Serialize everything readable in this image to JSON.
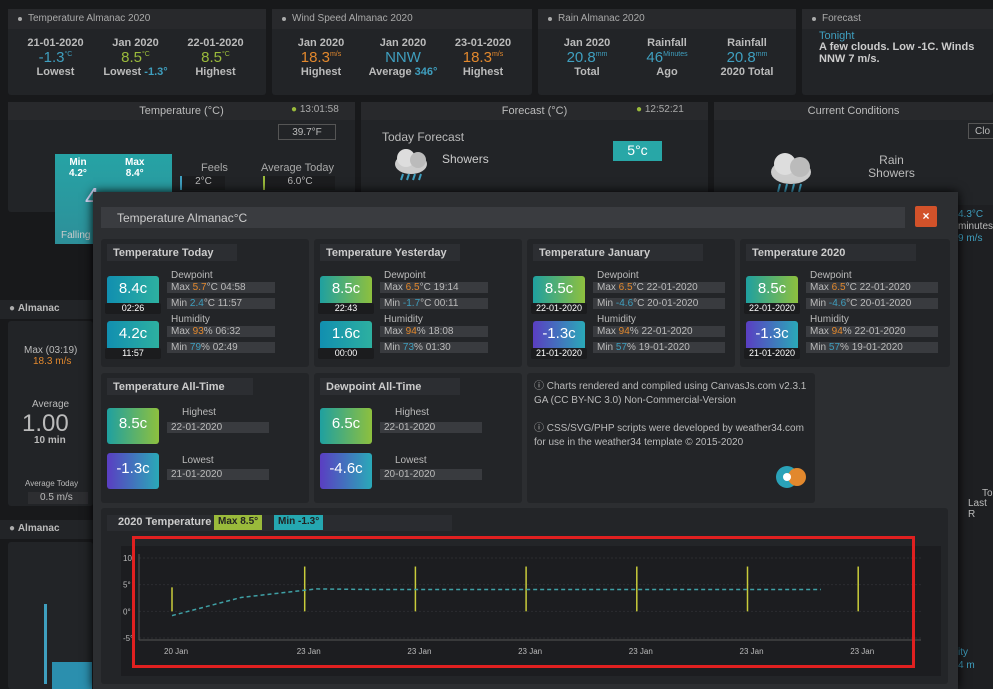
{
  "top": {
    "temp": {
      "title": "Temperature Almanac 2020",
      "cols": [
        {
          "h": "21-01-2020",
          "v": "-1.3",
          "u": "°C",
          "l": "Lowest"
        },
        {
          "h": "Jan 2020",
          "v": "8.5",
          "u": "°C",
          "l": "Lowest",
          "l2": "-1.3°"
        },
        {
          "h": "22-01-2020",
          "v": "8.5",
          "u": "°C",
          "l": "Highest"
        }
      ]
    },
    "wind": {
      "title": "Wind Speed Almanac 2020",
      "cols": [
        {
          "h": "Jan 2020",
          "v": "18.3",
          "u": "m/s",
          "l": "Highest"
        },
        {
          "h": "Jan 2020",
          "v": "NNW",
          "u": "",
          "l": "Average",
          "l2": "346°"
        },
        {
          "h": "23-01-2020",
          "v": "18.3",
          "u": "m/s",
          "l": "Highest"
        }
      ]
    },
    "rain": {
      "title": "Rain Almanac 2020",
      "cols": [
        {
          "h": "Jan 2020",
          "v": "20.8",
          "u": "mm",
          "l": "Total"
        },
        {
          "h": "Rainfall",
          "v": "46",
          "u": "Minutes",
          "l": "Ago"
        },
        {
          "h": "Rainfall",
          "v": "20.8",
          "u": "mm",
          "l": "2020 Total"
        }
      ]
    },
    "forecast": {
      "title": "Forecast",
      "tonight": "Tonight",
      "text": "A few clouds. Low -1C. Winds NNW 7 m/s."
    }
  },
  "second": {
    "temp": {
      "title": "Temperature (°C)",
      "time": "13:01:58",
      "feels_max": "39.7°F",
      "min_label": "Min",
      "min_val": "4.2°",
      "max_label": "Max",
      "max_val": "8.4°",
      "big": "4",
      "feels": "Feels",
      "feels_val": "2°C",
      "avg": "Average Today",
      "avg_val": "6.0°C",
      "falling": "Falling"
    },
    "forecast": {
      "title": "Forecast (°C)",
      "time": "12:52:21",
      "today": "Today Forecast",
      "cond": "Showers",
      "badge": "5°c"
    },
    "current": {
      "title": "Current Conditions",
      "btn": "Clo",
      "l1": "Rain",
      "l2": "Showers",
      "r1": "4.3°C",
      "r2": "minutes",
      "r3": "9 m/s"
    }
  },
  "left": {
    "almanac1": "Almanac",
    "max_lbl": "Max (03:19)",
    "max_val": "18.3 m/s",
    "avg_lbl": "Average",
    "avg_big": "1.00",
    "avg_unit": "10 min",
    "avgtoday_lbl": "Average Today",
    "avgtoday_val": "0.5 m/s",
    "almanac2": "Almanac",
    "t2": "To",
    "last": "Last R",
    "ity": "ity",
    "m4": "4 m"
  },
  "modal": {
    "title": "Temperature Almanac°C",
    "close": "×",
    "panels": [
      {
        "h": "Temperature Today",
        "c1": {
          "v": "8.4c",
          "d": "02:26"
        },
        "c2": {
          "v": "4.2c",
          "d": "11:57"
        },
        "dew": "Dewpoint",
        "dmax_pre": "Max ",
        "dmax_v": "5.7",
        "dmax_post": "°C 04:58",
        "dmin_pre": "Min ",
        "dmin_v": "2.4",
        "dmin_post": "°C 11:57",
        "hum": "Humidity",
        "hmax_pre": "Max ",
        "hmax_v": "93",
        "hmax_post": "% 06:32",
        "hmin_pre": "Min ",
        "hmin_v": "79",
        "hmin_post": "% 02:49"
      },
      {
        "h": "Temperature Yesterday",
        "c1": {
          "v": "8.5c",
          "d": "22:43"
        },
        "c2": {
          "v": "1.6c",
          "d": "00:00"
        },
        "dew": "Dewpoint",
        "dmax_pre": "Max ",
        "dmax_v": "6.5",
        "dmax_post": "°C 19:14",
        "dmin_pre": "Min ",
        "dmin_v": "-1.7",
        "dmin_post": "°C 00:11",
        "hum": "Humidity",
        "hmax_pre": "Max ",
        "hmax_v": "94",
        "hmax_post": "% 18:08",
        "hmin_pre": "Min ",
        "hmin_v": "73",
        "hmin_post": "% 01:30"
      },
      {
        "h": "Temperature January",
        "c1": {
          "v": "8.5c",
          "d": "22-01-2020"
        },
        "c2": {
          "v": "-1.3c",
          "d": "21-01-2020"
        },
        "dew": "Dewpoint",
        "dmax_pre": "Max ",
        "dmax_v": "6.5",
        "dmax_post": "°C 22-01-2020",
        "dmin_pre": "Min ",
        "dmin_v": "-4.6",
        "dmin_post": "°C 20-01-2020",
        "hum": "Humidity",
        "hmax_pre": "Max ",
        "hmax_v": "94",
        "hmax_post": "% 22-01-2020",
        "hmin_pre": "Min ",
        "hmin_v": "57",
        "hmin_post": "% 19-01-2020"
      },
      {
        "h": "Temperature 2020",
        "c1": {
          "v": "8.5c",
          "d": "22-01-2020"
        },
        "c2": {
          "v": "-1.3c",
          "d": "21-01-2020"
        },
        "dew": "Dewpoint",
        "dmax_pre": "Max ",
        "dmax_v": "6.5",
        "dmax_post": "°C 22-01-2020",
        "dmin_pre": "Min ",
        "dmin_v": "-4.6",
        "dmin_post": "°C 20-01-2020",
        "hum": "Humidity",
        "hmax_pre": "Max ",
        "hmax_v": "94",
        "hmax_post": "% 22-01-2020",
        "hmin_pre": "Min ",
        "hmin_v": "57",
        "hmin_post": "% 19-01-2020"
      }
    ],
    "alltime": {
      "h": "Temperature All-Time",
      "c1": "8.5c",
      "high": "Highest",
      "highd": "22-01-2020",
      "c2": "-1.3c",
      "low": "Lowest",
      "lowd": "21-01-2020"
    },
    "dewall": {
      "h": "Dewpoint All-Time",
      "c1": "6.5c",
      "high": "Highest",
      "highd": "22-01-2020",
      "c2": "-4.6c",
      "low": "Lowest",
      "lowd": "20-01-2020"
    },
    "info": {
      "l1": "ⓘ Charts rendered and compiled using CanvasJs.com v2.3.1 GA (CC BY-NC 3.0) Non-Commercial-Version",
      "l2": "ⓘ CSS/SVG/PHP scripts were developed by weather34.com for use in the weather34 template © 2015-2020"
    },
    "chart_title": "2020 Temperature",
    "max_badge": "Max 8.5°",
    "min_badge": "Min -1.3°"
  },
  "colors": {
    "accent_orange": "#e2882d",
    "accent_blue": "#3f9fbf",
    "accent_green": "#9aba3b",
    "close_red": "#d2522a",
    "highlight_box": "#e02020"
  },
  "chart_data": {
    "type": "line",
    "title": "2020 Temperature",
    "x": [
      "20 Jan",
      "23 Jan",
      "23 Jan",
      "23 Jan",
      "23 Jan",
      "23 Jan",
      "23 Jan",
      "23 Jan"
    ],
    "ylim": [
      -5,
      10
    ],
    "yticks": [
      "10°",
      "5°",
      "0°",
      "-5°"
    ],
    "ytick_values": [
      10,
      5,
      0,
      -5
    ],
    "series": [
      {
        "values": [
          -0.8,
          2.6,
          4.2,
          4.1,
          4.1,
          4.1,
          4.1,
          4.1
        ],
        "color": "#3fa0a5",
        "dashed": true
      }
    ],
    "ranges": [
      {
        "low": 0,
        "high": 4.5
      },
      {
        "low": 0,
        "high": 8.4
      },
      {
        "low": 0,
        "high": 8.4
      },
      {
        "low": 0,
        "high": 8.4
      },
      {
        "low": 0,
        "high": 8.4
      },
      {
        "low": 0,
        "high": 8.4
      },
      {
        "low": 0,
        "high": 8.4
      }
    ],
    "grid": true
  }
}
